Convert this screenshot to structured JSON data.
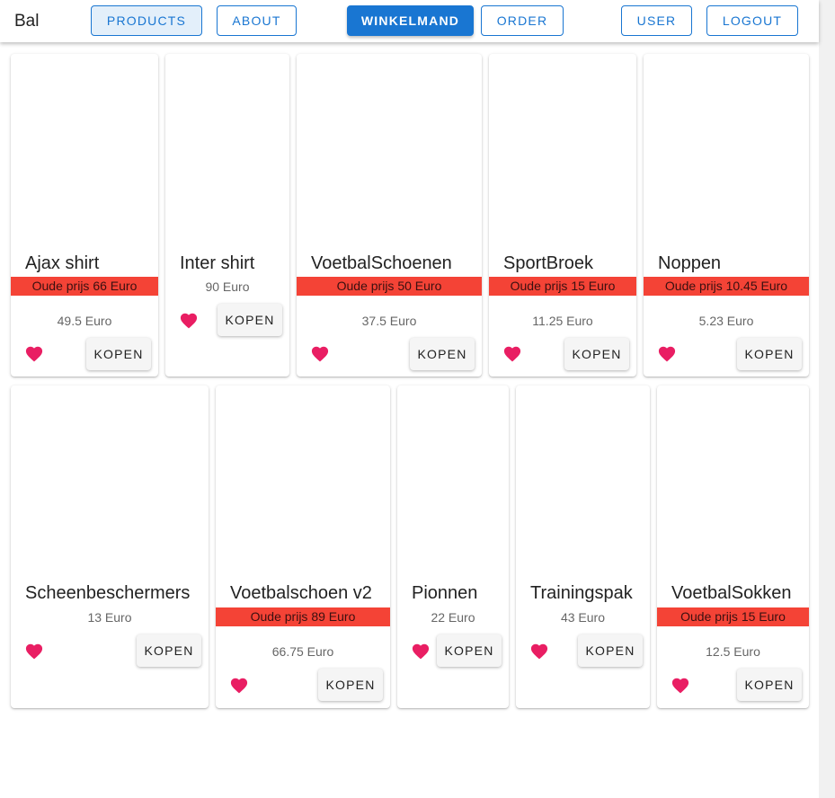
{
  "appbar": {
    "brand": "Bal",
    "nav": [
      {
        "label": "PRODUCTS"
      },
      {
        "label": "ABOUT"
      },
      {
        "label": "WINKELMAND"
      },
      {
        "label": "ORDER"
      },
      {
        "label": "USER"
      },
      {
        "label": "LOGOUT"
      }
    ]
  },
  "colors": {
    "primary": "#1976d2",
    "sale": "#f44336",
    "heart": "#e91e63"
  },
  "products": [
    {
      "name": "Ajax shirt",
      "old_price": "Oude prijs 66 Euro",
      "price": "49.5 Euro",
      "buy_label": "KOPEN",
      "heart_icon": "heart-icon"
    },
    {
      "name": "Inter shirt",
      "price": "90 Euro",
      "buy_label": "KOPEN",
      "heart_icon": "heart-icon"
    },
    {
      "name": "VoetbalSchoenen",
      "old_price": "Oude prijs 50 Euro",
      "price": "37.5 Euro",
      "buy_label": "KOPEN",
      "heart_icon": "heart-icon"
    },
    {
      "name": "SportBroek",
      "old_price": "Oude prijs 15 Euro",
      "price": "11.25 Euro",
      "buy_label": "KOPEN",
      "heart_icon": "heart-icon"
    },
    {
      "name": "Noppen",
      "old_price": "Oude prijs 10.45 Euro",
      "price": "5.23 Euro",
      "buy_label": "KOPEN",
      "heart_icon": "heart-icon"
    },
    {
      "name": "Scheenbeschermers",
      "price": "13 Euro",
      "buy_label": "KOPEN",
      "heart_icon": "heart-icon"
    },
    {
      "name": "Voetbalschoen v2",
      "old_price": "Oude prijs 89 Euro",
      "price": "66.75 Euro",
      "buy_label": "KOPEN",
      "heart_icon": "heart-icon"
    },
    {
      "name": "Pionnen",
      "price": "22 Euro",
      "buy_label": "KOPEN",
      "heart_icon": "heart-icon"
    },
    {
      "name": "Trainingspak",
      "price": "43 Euro",
      "buy_label": "KOPEN",
      "heart_icon": "heart-icon"
    },
    {
      "name": "VoetbalSokken",
      "old_price": "Oude prijs 15 Euro",
      "price": "12.5 Euro",
      "buy_label": "KOPEN",
      "heart_icon": "heart-icon"
    }
  ]
}
